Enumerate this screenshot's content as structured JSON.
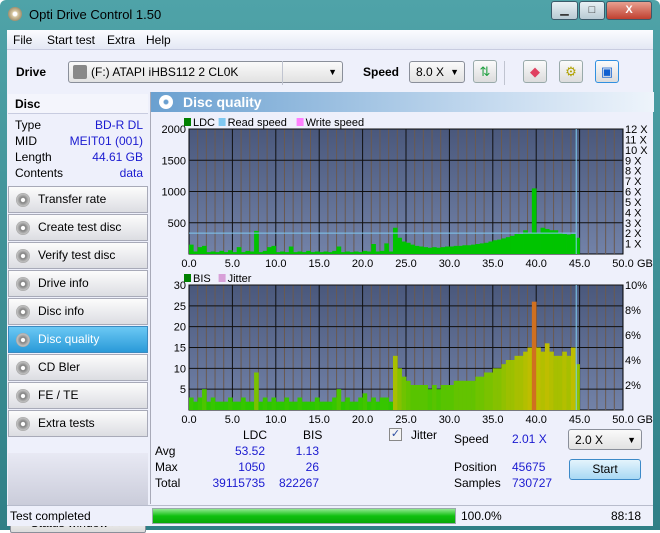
{
  "window": {
    "title": "Opti Drive Control 1.50",
    "minimize": "▁",
    "maximize": "□",
    "close": "X"
  },
  "menu": [
    "File",
    "Start test",
    "Extra",
    "Help"
  ],
  "toolbar": {
    "drive_label": "Drive",
    "drive_value": "(F:)   ATAPI iHBS112   2 CL0K",
    "speed_label": "Speed",
    "speed_value": "8.0 X"
  },
  "disc": {
    "header": "Disc",
    "rows": [
      {
        "k": "Type",
        "v": "BD-R DL"
      },
      {
        "k": "MID",
        "v": "MEIT01 (001)"
      },
      {
        "k": "Length",
        "v": "44.61 GB"
      },
      {
        "k": "Contents",
        "v": "data"
      }
    ]
  },
  "nav": [
    "Transfer rate",
    "Create test disc",
    "Verify test disc",
    "Drive info",
    "Disc info",
    "Disc quality",
    "CD Bler",
    "FE / TE",
    "Extra tests"
  ],
  "nav_selected": "Disc quality",
  "status_window_button": "Status window >>",
  "panel": {
    "title": "Disc quality"
  },
  "colors": {
    "ldc": "#008000",
    "read_speed": "#80c8f0",
    "write_speed": "#ff80ff",
    "bis": "#008000",
    "jitter": "#d8a0d8",
    "selected_nav": "#2a9ad8",
    "progress": "#20c020"
  },
  "chart_data": [
    {
      "type": "bar",
      "legend": [
        "LDC",
        "Read speed",
        "Write speed"
      ],
      "xlim": [
        0,
        50
      ],
      "ylim": [
        0,
        2000
      ],
      "y2lim": [
        0,
        12
      ],
      "xticks": [
        "0.0",
        "5.0",
        "10.0",
        "15.0",
        "20.0",
        "25.0",
        "30.0",
        "35.0",
        "40.0",
        "45.0",
        "50.0"
      ],
      "xunit": "GB",
      "yticks": [
        "500",
        "1000",
        "1500",
        "2000"
      ],
      "y2ticks": [
        "1 X",
        "2 X",
        "3 X",
        "4 X",
        "5 X",
        "6 X",
        "7 X",
        "8 X",
        "9 X",
        "10 X",
        "11 X",
        "12 X"
      ],
      "x_step": 0.5,
      "ldc": [
        150,
        40,
        110,
        130,
        30,
        40,
        30,
        50,
        30,
        60,
        30,
        110,
        30,
        50,
        40,
        370,
        30,
        50,
        110,
        130,
        30,
        40,
        30,
        120,
        30,
        40,
        30,
        50,
        30,
        40,
        30,
        40,
        30,
        50,
        120,
        30,
        40,
        30,
        40,
        30,
        50,
        40,
        160,
        40,
        50,
        170,
        40,
        420,
        260,
        200,
        180,
        150,
        130,
        120,
        110,
        100,
        110,
        100,
        110,
        120,
        120,
        130,
        130,
        140,
        140,
        150,
        160,
        170,
        180,
        200,
        220,
        230,
        250,
        270,
        290,
        320,
        320,
        380,
        330,
        1050,
        340,
        420,
        400,
        380,
        380,
        330,
        320,
        310,
        320,
        260
      ],
      "read_speed": {
        "x": [
          0,
          44.6
        ],
        "y": [
          2.0,
          2.0
        ]
      },
      "end_marker_gb": 44.61
    },
    {
      "type": "bar",
      "legend": [
        "BIS",
        "Jitter"
      ],
      "xlim": [
        0,
        50
      ],
      "ylim": [
        0,
        30
      ],
      "y2lim": [
        0,
        10
      ],
      "xticks": [
        "0.0",
        "5.0",
        "10.0",
        "15.0",
        "20.0",
        "25.0",
        "30.0",
        "35.0",
        "40.0",
        "45.0",
        "50.0"
      ],
      "xunit": "GB",
      "yticks": [
        "5",
        "10",
        "15",
        "20",
        "25",
        "30"
      ],
      "y2ticks": [
        "2%",
        "4%",
        "6%",
        "8%",
        "10%"
      ],
      "x_step": 0.5,
      "bis": [
        3,
        2,
        3,
        5,
        2,
        3,
        2,
        2,
        2,
        3,
        2,
        2,
        3,
        2,
        2,
        9,
        2,
        3,
        2,
        3,
        2,
        2,
        3,
        2,
        2,
        3,
        2,
        2,
        2,
        3,
        2,
        2,
        2,
        3,
        5,
        2,
        3,
        2,
        2,
        3,
        4,
        2,
        3,
        2,
        3,
        3,
        2,
        13,
        10,
        8,
        7,
        6,
        6,
        6,
        6,
        5,
        6,
        5,
        6,
        6,
        6,
        7,
        7,
        7,
        7,
        7,
        8,
        8,
        9,
        9,
        10,
        10,
        11,
        12,
        12,
        13,
        13,
        14,
        15,
        26,
        15,
        14,
        16,
        14,
        13,
        13,
        14,
        13,
        15,
        11
      ],
      "end_marker_gb": 44.61
    }
  ],
  "stats": {
    "col_ldc": "LDC",
    "col_bis": "BIS",
    "rows": [
      {
        "k": "Avg",
        "ldc": "53.52",
        "bis": "1.13"
      },
      {
        "k": "Max",
        "ldc": "1050",
        "bis": "26"
      },
      {
        "k": "Total",
        "ldc": "39115735",
        "bis": "822267"
      }
    ],
    "jitter_label": "Jitter",
    "jitter_checked": true,
    "speed_label": "Speed",
    "speed_value": "2.01 X",
    "speed_select": "2.0 X",
    "position_label": "Position",
    "position_value": "45675",
    "samples_label": "Samples",
    "samples_value": "730727",
    "start_button": "Start"
  },
  "statusbar": {
    "text": "Test completed",
    "progress_text": "100.0%",
    "progress": 1.0,
    "time": "88:18"
  }
}
